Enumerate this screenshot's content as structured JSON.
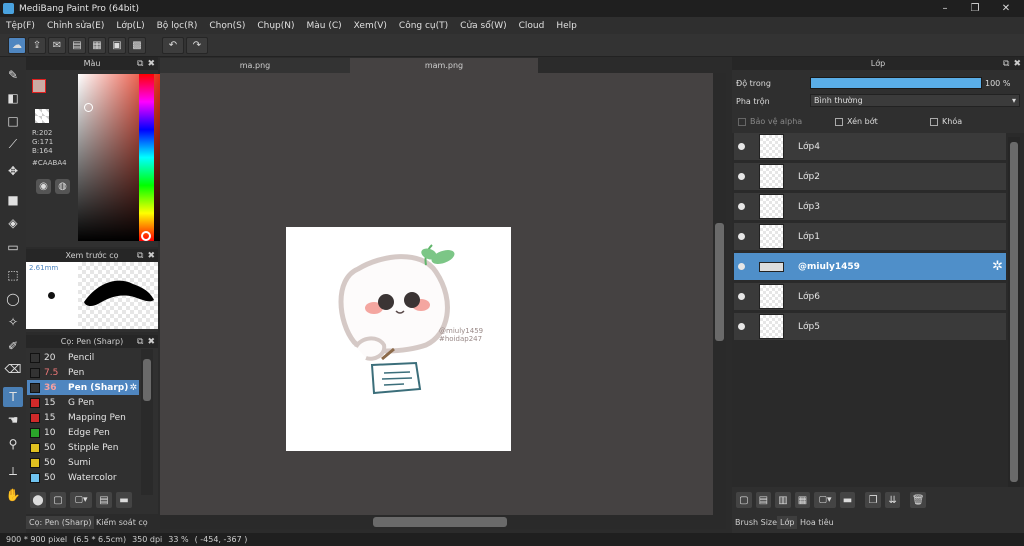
{
  "window": {
    "title": "MediBang Paint Pro (64bit)",
    "minimize": "–",
    "maximize": "❐",
    "close": "✕"
  },
  "menu": [
    "Tệp(F)",
    "Chỉnh sửa(E)",
    "Lớp(L)",
    "Bộ lọc(R)",
    "Chọn(S)",
    "Chụp(N)",
    "Màu (C)",
    "Xem(V)",
    "Công cụ(T)",
    "Cửa sổ(W)",
    "Cloud",
    "Help"
  ],
  "toolbar": {
    "undo_icon": "↶",
    "redo_icon": "↷"
  },
  "color_panel": {
    "title": "Màu",
    "r": "R:202",
    "g": "G:171",
    "b": "B:164",
    "hex": "#CAABA4",
    "primary_color": "#CAABA4",
    "accent": "#e02020"
  },
  "brush_preview": {
    "title": "Xem trước cọ",
    "size": "2.61mm"
  },
  "brush_panel": {
    "title": "Cọ: Pen (Sharp)",
    "brushes": [
      {
        "size": "20",
        "name": "Pencil",
        "color": "#333333"
      },
      {
        "size": "7.5",
        "name": "Pen",
        "color": "#333333"
      },
      {
        "size": "36",
        "name": "Pen (Sharp)",
        "color": "#333333"
      },
      {
        "size": "15",
        "name": "G Pen",
        "color": "#d02a2a"
      },
      {
        "size": "15",
        "name": "Mapping Pen",
        "color": "#d02a2a"
      },
      {
        "size": "10",
        "name": "Edge Pen",
        "color": "#2aa52a"
      },
      {
        "size": "50",
        "name": "Stipple Pen",
        "color": "#e0c020"
      },
      {
        "size": "50",
        "name": "Sumi",
        "color": "#e0c020"
      },
      {
        "size": "50",
        "name": "Watercolor",
        "color": "#6fc3f0"
      }
    ]
  },
  "bottom_left_tabs": [
    "Cọ: Pen (Sharp)",
    "Kiểm soát cọ"
  ],
  "canvas_tabs": [
    "ma.png",
    "mam.png"
  ],
  "canvas": {
    "watermark": "@miuly1459",
    "watermark2": "#hoidap247"
  },
  "layer_panel": {
    "title": "Lớp",
    "opacity_label": "Độ trong",
    "opacity_value": "100 %",
    "opacity_level": 1.0,
    "blend_label": "Pha trộn",
    "blend_value": "Bình thường",
    "protect_alpha": "Bảo vệ alpha",
    "clipping": "Xén bớt",
    "lock": "Khóa",
    "layers": [
      {
        "name": "Lớp4",
        "selected": false
      },
      {
        "name": "Lớp2",
        "selected": false
      },
      {
        "name": "Lớp3",
        "selected": false
      },
      {
        "name": "Lớp1",
        "selected": false
      },
      {
        "name": "@miuly1459",
        "selected": true
      },
      {
        "name": "Lớp6",
        "selected": false
      },
      {
        "name": "Lớp5",
        "selected": false
      }
    ]
  },
  "right_bottom_tabs": [
    "Brush Size",
    "Lớp",
    "Hoa tiêu"
  ],
  "status": {
    "size": "900 * 900 pixel",
    "dims": "(6.5 * 6.5cm)",
    "dpi": "350 dpi",
    "zoom": "33 %",
    "coords": "( -454, -367 )"
  }
}
